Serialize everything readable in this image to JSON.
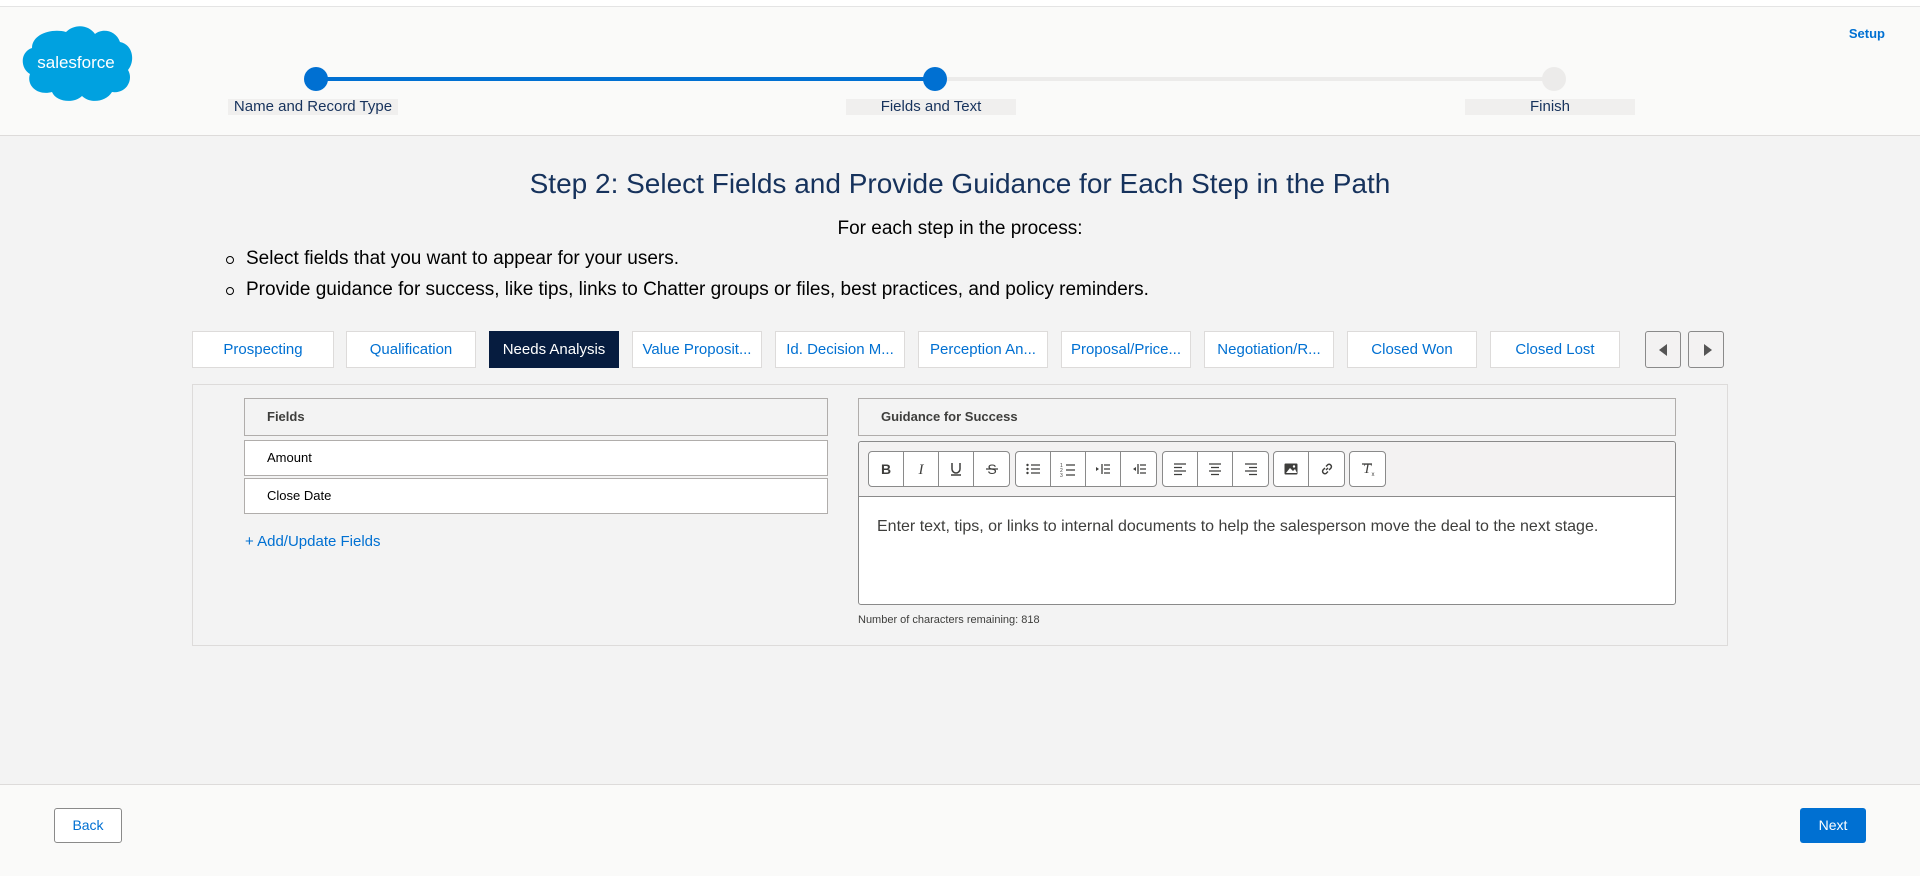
{
  "header": {
    "logo_text": "salesforce",
    "setup_label": "Setup",
    "steps": [
      {
        "label": "Name and Record Type",
        "status": "complete"
      },
      {
        "label": "Fields and Text",
        "status": "current"
      },
      {
        "label": "Finish",
        "status": "incomplete"
      }
    ],
    "progress_fraction": 0.5
  },
  "main": {
    "title": "Step 2: Select Fields and Provide Guidance for Each Step in the Path",
    "subtitle": "For each step in the process:",
    "bullets": [
      "Select fields that you want to appear for your users.",
      "Provide guidance for success, like tips, links to Chatter groups or files, best practices, and policy reminders."
    ],
    "tabs": [
      {
        "label": "Prospecting",
        "active": false
      },
      {
        "label": "Qualification",
        "active": false
      },
      {
        "label": "Needs Analysis",
        "active": true
      },
      {
        "label": "Value Proposit...",
        "active": false
      },
      {
        "label": "Id. Decision M...",
        "active": false
      },
      {
        "label": "Perception An...",
        "active": false
      },
      {
        "label": "Proposal/Price...",
        "active": false
      },
      {
        "label": "Negotiation/R...",
        "active": false
      },
      {
        "label": "Closed Won",
        "active": false
      },
      {
        "label": "Closed Lost",
        "active": false
      }
    ],
    "fields": {
      "header": "Fields",
      "rows": [
        "Amount",
        "Close Date"
      ],
      "add_link": "+ Add/Update Fields"
    },
    "guidance": {
      "header": "Guidance for Success",
      "toolbar": [
        "bold-icon",
        "italic-icon",
        "underline-icon",
        "strikethrough-icon",
        "bulleted-list-icon",
        "numbered-list-icon",
        "indent-icon",
        "outdent-icon",
        "align-left-icon",
        "align-center-icon",
        "align-right-icon",
        "image-icon",
        "link-icon",
        "clear-formatting-icon"
      ],
      "placeholder": "Enter text, tips, or links to internal documents to help the salesperson move the deal to the next stage.",
      "char_count": "Number of characters remaining: 818"
    }
  },
  "footer": {
    "back_label": "Back",
    "next_label": "Next"
  },
  "colors": {
    "brand_blue": "#0070d2",
    "active_tab": "#061c3f",
    "salesforce_cloud": "#00a1e0"
  }
}
